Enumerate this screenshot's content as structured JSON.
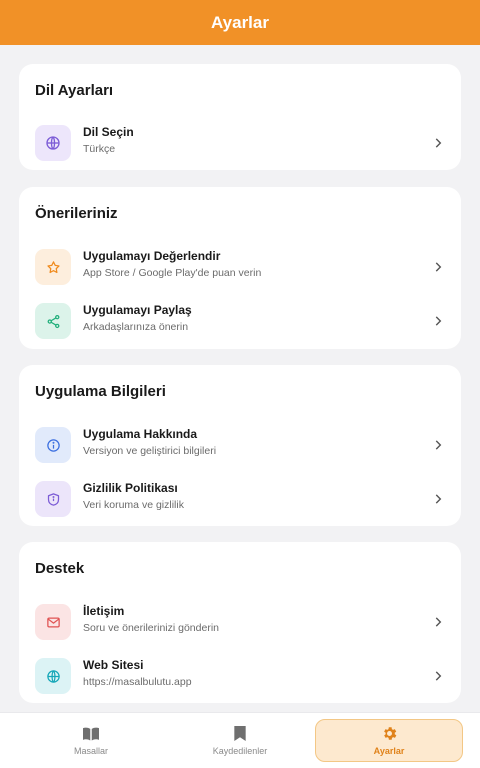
{
  "header": {
    "title": "Ayarlar"
  },
  "colors": {
    "accent": "#f19127",
    "background": "#f2f2f4",
    "purple": "#7c5cd6",
    "orange": "#f08a1c",
    "green": "#1fae7a",
    "blue": "#3b6fe0",
    "red": "#e05252",
    "cyan": "#16a7b8"
  },
  "sections": {
    "language": {
      "title": "Dil Ayarları",
      "items": [
        {
          "title": "Dil Seçin",
          "subtitle": "Türkçe",
          "icon": "globe-icon"
        }
      ]
    },
    "suggestions": {
      "title": "Önerileriniz",
      "items": [
        {
          "title": "Uygulamayı Değerlendir",
          "subtitle": "App Store / Google Play'de puan verin",
          "icon": "star-icon"
        },
        {
          "title": "Uygulamayı Paylaş",
          "subtitle": "Arkadaşlarınıza önerin",
          "icon": "share-icon"
        }
      ]
    },
    "app_info": {
      "title": "Uygulama Bilgileri",
      "items": [
        {
          "title": "Uygulama Hakkında",
          "subtitle": "Versiyon ve geliştirici bilgileri",
          "icon": "info-icon"
        },
        {
          "title": "Gizlilik Politikası",
          "subtitle": "Veri koruma ve gizlilik",
          "icon": "shield-icon"
        }
      ]
    },
    "support": {
      "title": "Destek",
      "items": [
        {
          "title": "İletişim",
          "subtitle": "Soru ve önerilerinizi gönderin",
          "icon": "mail-icon"
        },
        {
          "title": "Web Sitesi",
          "subtitle": "https://masalbulutu.app",
          "icon": "globe-icon"
        }
      ]
    }
  },
  "tabs": [
    {
      "label": "Masallar",
      "icon": "book-icon",
      "active": false
    },
    {
      "label": "Kaydedilenler",
      "icon": "bookmark-icon",
      "active": false
    },
    {
      "label": "Ayarlar",
      "icon": "gear-icon",
      "active": true
    }
  ]
}
